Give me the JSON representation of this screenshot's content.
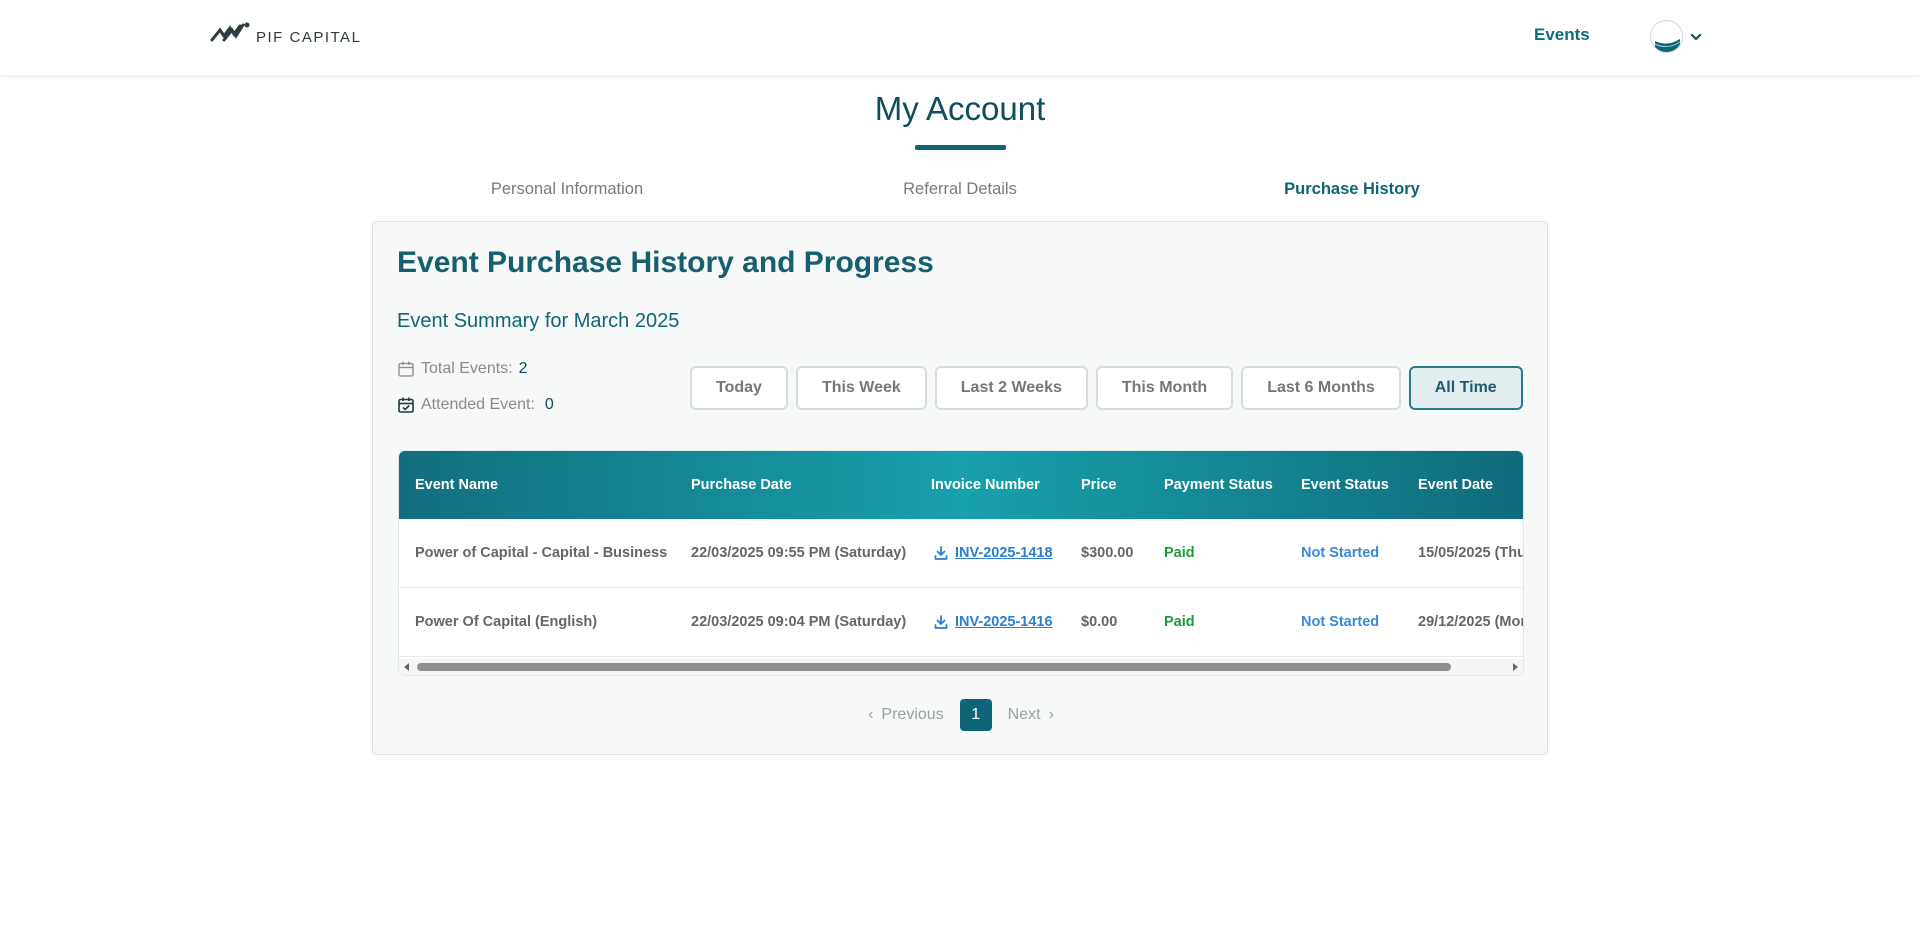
{
  "header": {
    "logo_text": "PIF CAPITAL",
    "nav_events": "Events"
  },
  "page": {
    "title": "My Account"
  },
  "tabs": [
    {
      "label": "Personal Information",
      "active": false
    },
    {
      "label": "Referral Details",
      "active": false
    },
    {
      "label": "Purchase History",
      "active": true
    }
  ],
  "card": {
    "title": "Event Purchase History and Progress",
    "summary_title": "Event Summary for March 2025",
    "stats": {
      "total_label": "Total Events:",
      "total_value": "2",
      "attended_label": "Attended Event:",
      "attended_value": "0"
    },
    "filters": [
      {
        "label": "Today",
        "active": false
      },
      {
        "label": "This Week",
        "active": false
      },
      {
        "label": "Last 2 Weeks",
        "active": false
      },
      {
        "label": "This Month",
        "active": false
      },
      {
        "label": "Last 6 Months",
        "active": false
      },
      {
        "label": "All Time",
        "active": true
      }
    ]
  },
  "table": {
    "columns": [
      "Event Name",
      "Purchase Date",
      "Invoice Number",
      "Price",
      "Payment Status",
      "Event Status",
      "Event Date"
    ],
    "rows": [
      {
        "event_name": "Power of Capital - Capital - Business",
        "purchase_date": "22/03/2025 09:55 PM (Saturday)",
        "invoice": "INV-2025-1418",
        "price": "$300.00",
        "payment_status": "Paid",
        "event_status": "Not Started",
        "event_date": "15/05/2025 (Thu"
      },
      {
        "event_name": "Power Of Capital (English)",
        "purchase_date": "22/03/2025 09:04 PM (Saturday)",
        "invoice": "INV-2025-1416",
        "price": "$0.00",
        "payment_status": "Paid",
        "event_status": "Not Started",
        "event_date": "29/12/2025 (Mon"
      }
    ]
  },
  "pagination": {
    "previous": "Previous",
    "current": "1",
    "next": "Next"
  },
  "colors": {
    "brand": "#0d6577",
    "paid": "#1f9a3a",
    "not_started": "#3b88d8"
  }
}
